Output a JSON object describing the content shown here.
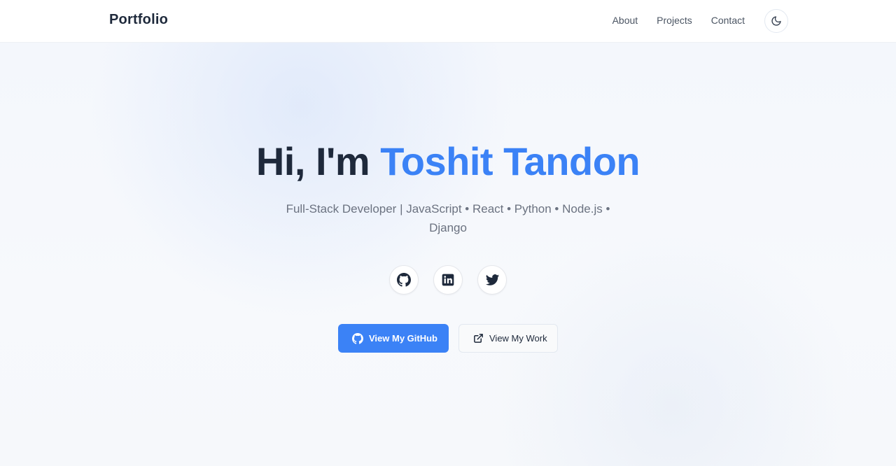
{
  "header": {
    "brand": "Portfolio",
    "nav": [
      "About",
      "Projects",
      "Contact"
    ],
    "theme_toggle_icon": "moon-icon"
  },
  "hero": {
    "greeting": "Hi, I'm",
    "name": "Toshit Tandon",
    "tagline": "Full-Stack Developer | JavaScript • React • Python • Node.js • Django",
    "social_icons": [
      "github-icon",
      "linkedin-icon",
      "twitter-icon"
    ],
    "primary_button": {
      "label": "View My GitHub",
      "icon": "github-icon"
    },
    "secondary_button": {
      "label": "View My Work",
      "icon": "external-link-icon"
    }
  },
  "colors": {
    "accent": "#3b82f6",
    "text_dark": "#1e293b",
    "text_muted": "#6b7280",
    "header_bg": "#ffffff",
    "hero_bg": "#f4f7fc"
  }
}
